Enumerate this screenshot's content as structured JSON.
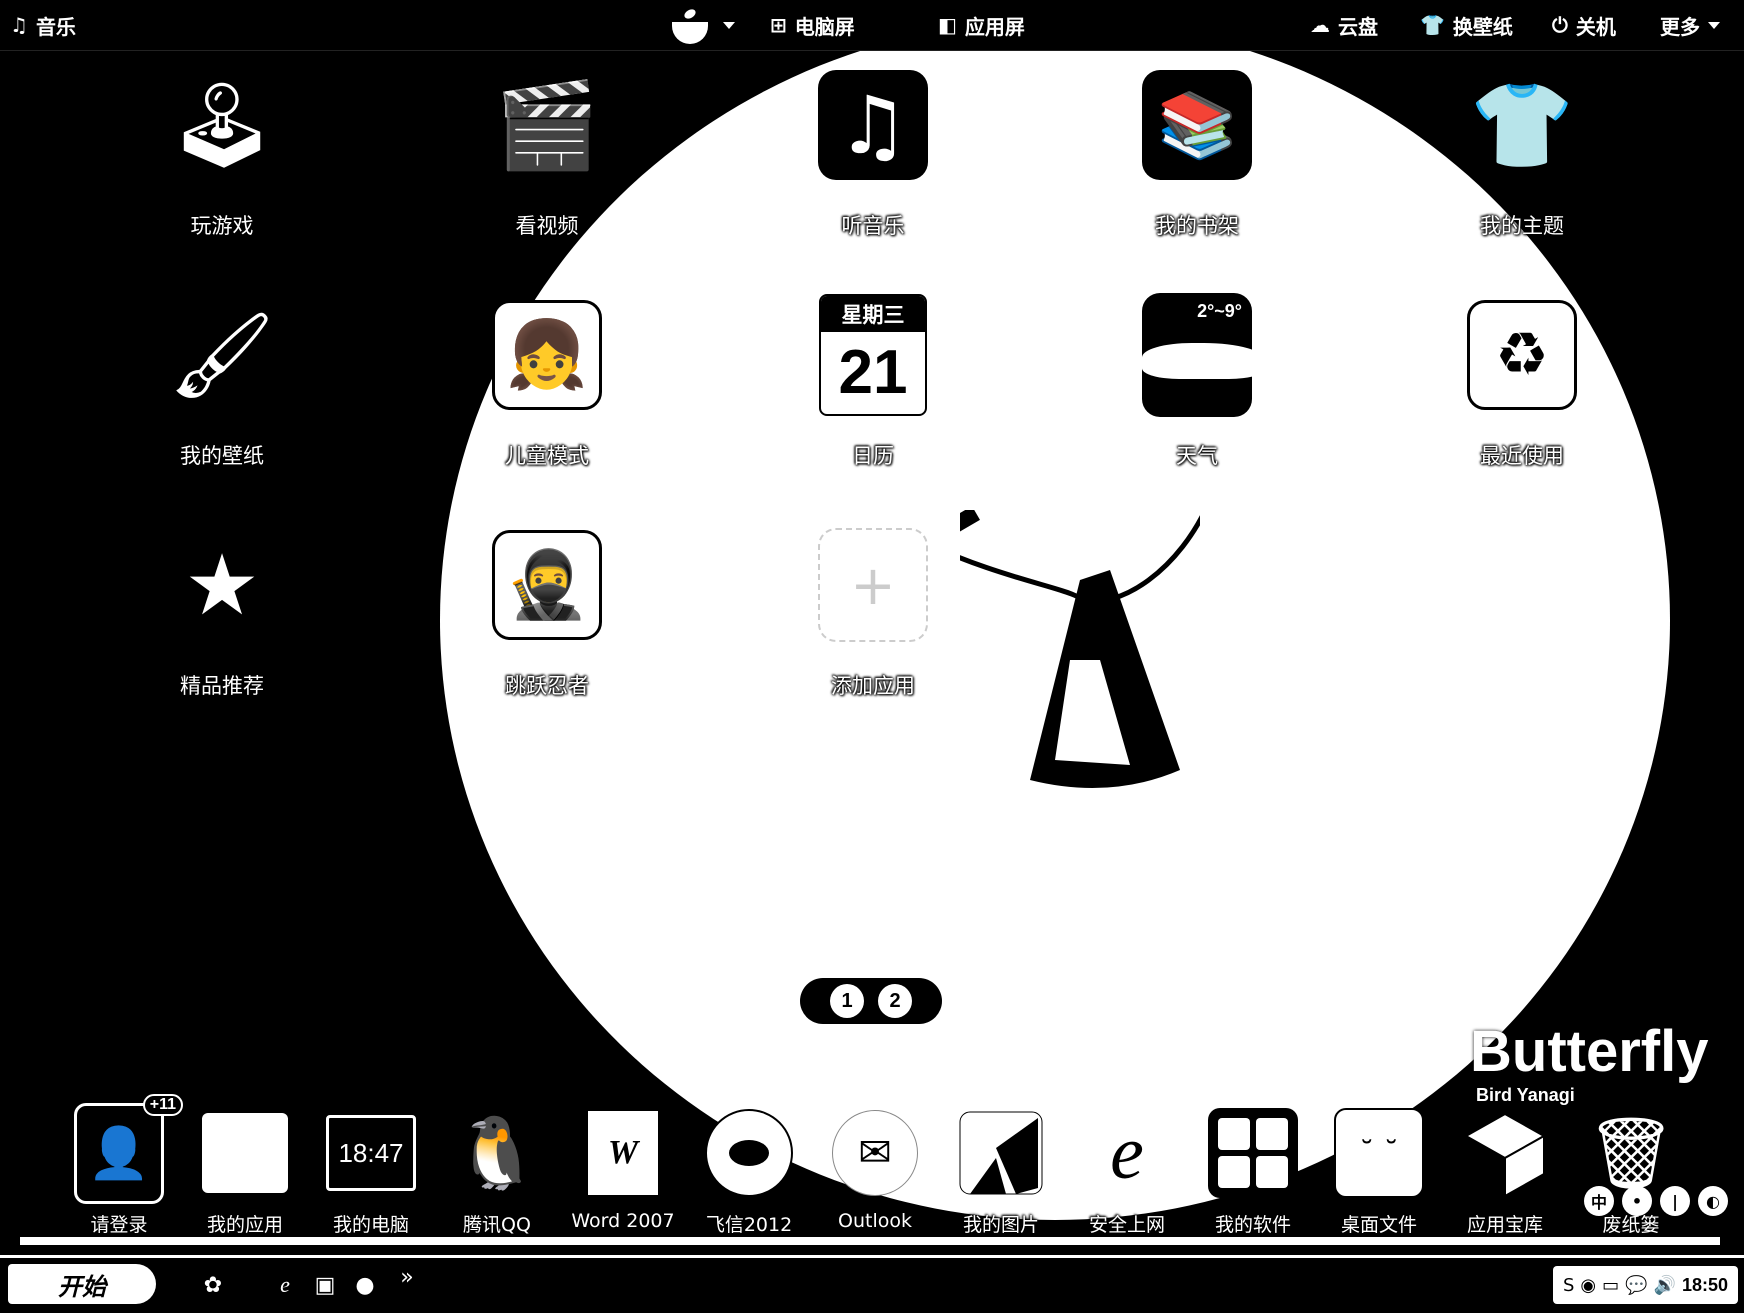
{
  "topbar": {
    "music": {
      "icon": "music-note-icon",
      "label": "音乐"
    },
    "avatar": {
      "icon": "skin-bowl-icon"
    },
    "tabs": [
      {
        "icon": "windows-icon",
        "label": "电脑屏"
      },
      {
        "icon": "cube-icon",
        "label": "应用屏"
      }
    ],
    "right": [
      {
        "icon": "cloud-icon",
        "label": "云盘"
      },
      {
        "icon": "tshirt-icon",
        "label": "换壁纸"
      },
      {
        "icon": "power-icon",
        "label": "关机"
      },
      {
        "icon": "chevron-down-icon",
        "label": "更多"
      }
    ]
  },
  "apps": [
    {
      "label": "玩游戏",
      "icon": "joystick-icon"
    },
    {
      "label": "看视频",
      "icon": "clapperboard-icon"
    },
    {
      "label": "听音乐",
      "icon": "music-note-icon"
    },
    {
      "label": "我的书架",
      "icon": "bookshelf-icon"
    },
    {
      "label": "我的主题",
      "icon": "tshirt-icon"
    },
    {
      "label": "我的壁纸",
      "icon": "wallpaper-brush-icon"
    },
    {
      "label": "儿童模式",
      "icon": "child-face-icon"
    },
    {
      "label": "日历",
      "icon": "calendar-icon"
    },
    {
      "label": "天气",
      "icon": "weather-cloud-icon"
    },
    {
      "label": "最近使用",
      "icon": "recent-recycle-icon"
    },
    {
      "label": "精品推荐",
      "icon": "star-icon"
    },
    {
      "label": "跳跃忍者",
      "icon": "ninja-game-icon"
    },
    {
      "label": "添加应用",
      "icon": "add-icon"
    }
  ],
  "calendar": {
    "weekday": "星期三",
    "day": "21"
  },
  "weather": {
    "temp": "2°~9°"
  },
  "pager": {
    "pages": [
      "1",
      "2"
    ],
    "current": 1
  },
  "now_playing": {
    "title": "Butterfly",
    "artist": "Bird Yanagi"
  },
  "dock": [
    {
      "label": "请登录",
      "icon": "user-login-icon",
      "badge": "+11"
    },
    {
      "label": "我的应用",
      "icon": "app-box-icon"
    },
    {
      "label": "我的电脑",
      "icon": "monitor-icon",
      "time": "18:47"
    },
    {
      "label": "腾讯QQ",
      "icon": "qq-penguin-icon"
    },
    {
      "label": "Word 2007",
      "icon": "word-icon"
    },
    {
      "label": "飞信2012",
      "icon": "fetion-icon"
    },
    {
      "label": "Outlook",
      "icon": "outlook-icon"
    },
    {
      "label": "我的图片",
      "icon": "pictures-icon"
    },
    {
      "label": "安全上网",
      "icon": "ie-browser-icon"
    },
    {
      "label": "我的软件",
      "icon": "software-grid-icon"
    },
    {
      "label": "桌面文件",
      "icon": "desktop-files-icon"
    },
    {
      "label": "应用宝库",
      "icon": "app-store-cube-icon"
    },
    {
      "label": "废纸篓",
      "icon": "trash-icon"
    }
  ],
  "ime": [
    "中",
    "•",
    "|",
    "◐"
  ],
  "taskbar": {
    "start_label": "开始",
    "quick_launch": [
      "ie-icon",
      "folder-icon",
      "media-icon"
    ],
    "more": "»",
    "tray_clock": "18:50"
  }
}
